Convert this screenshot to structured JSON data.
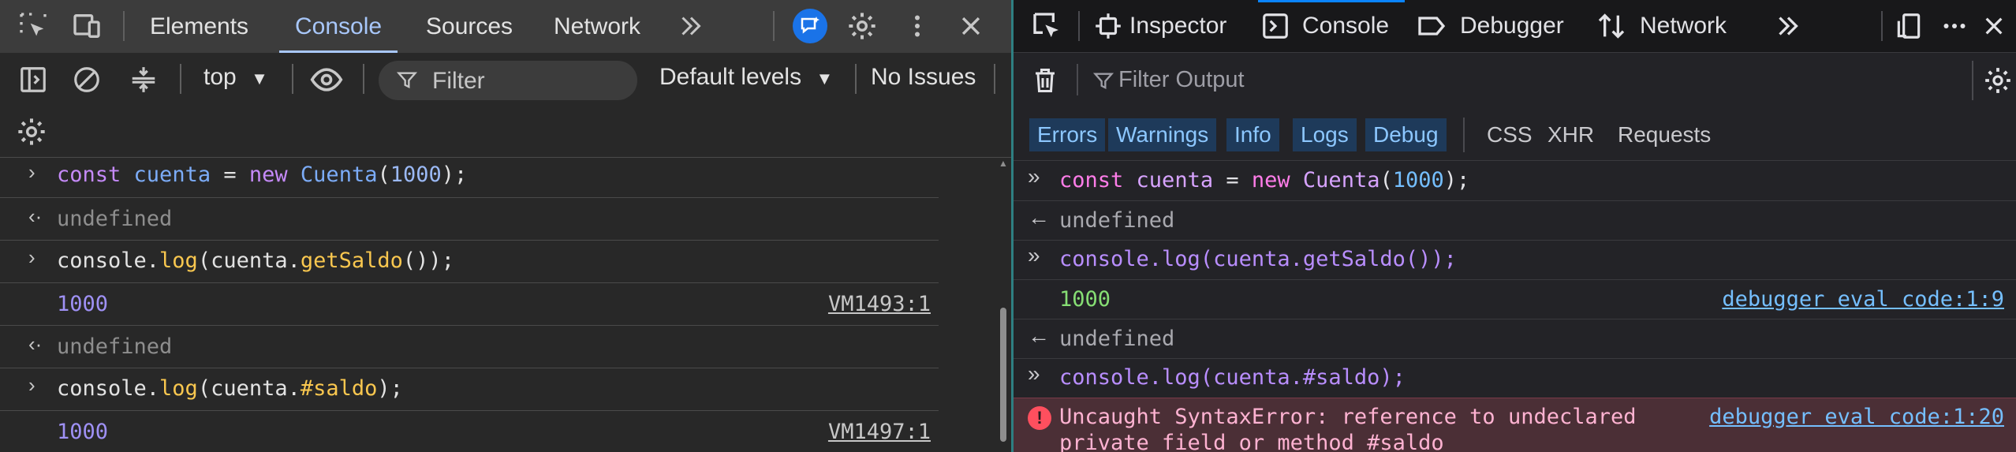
{
  "chrome": {
    "tabs": [
      "Elements",
      "Console",
      "Sources",
      "Network"
    ],
    "active_tab": "Console",
    "toolbar": {
      "context": "top",
      "filter_placeholder": "Filter",
      "levels": "Default levels",
      "issues": "No Issues"
    },
    "log": {
      "r1": {
        "kw": "const",
        "var": "cuenta",
        "eq": " = ",
        "new": "new",
        "cls": "Cuenta",
        "open": "(",
        "num": "1000",
        "close": ");"
      },
      "r2": {
        "text": "undefined"
      },
      "r3": {
        "a": "console.",
        "b": "log",
        "c": "(cuenta.",
        "d": "getSaldo",
        "e": "());"
      },
      "r4": {
        "value": "1000",
        "source": "VM1493:1"
      },
      "r5": {
        "text": "undefined"
      },
      "r6": {
        "a": "console.",
        "b": "log",
        "c": "(cuenta.",
        "d": "#saldo",
        "e": ");"
      },
      "r7": {
        "value": "1000",
        "source": "VM1497:1"
      }
    }
  },
  "firefox": {
    "tabs": [
      "Inspector",
      "Console",
      "Debugger",
      "Network"
    ],
    "active_tab": "Console",
    "filter_placeholder": "Filter Output",
    "levels": [
      "Errors",
      "Warnings",
      "Info",
      "Logs",
      "Debug"
    ],
    "extra_filters": [
      "CSS",
      "XHR",
      "Requests"
    ],
    "log": {
      "r1": {
        "kw": "const",
        "var": "cuenta",
        "eq": " = ",
        "new": "new",
        "cls": "Cuenta",
        "open": "(",
        "num": "1000",
        "close": ");"
      },
      "r2": {
        "text": "undefined"
      },
      "r3": {
        "text": "console.log(cuenta.getSaldo());"
      },
      "r4": {
        "value": "1000",
        "source": "debugger eval code:1:9"
      },
      "r5": {
        "text": "undefined"
      },
      "r6": {
        "text": "console.log(cuenta.#saldo);"
      },
      "r7": {
        "line1": "Uncaught SyntaxError: reference to undeclared",
        "line2": "private field or method #saldo",
        "source": "debugger eval code:1:20"
      }
    }
  },
  "colors": {
    "chrome_accent": "#a8c7fa",
    "firefox_accent": "#0a84ff",
    "error_bg": "#4b2f36",
    "divider": "#2e7f82"
  }
}
